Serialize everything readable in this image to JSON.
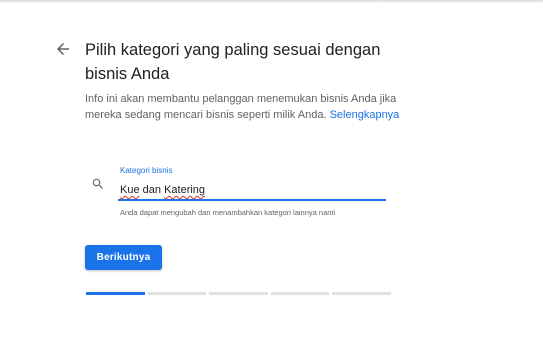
{
  "header": {
    "title": "Pilih kategori yang paling sesuai dengan bisnis Anda"
  },
  "description": {
    "text": "Info ini akan membantu pelanggan menemukan bisnis Anda jika mereka sedang mencari bisnis seperti milik Anda.",
    "link_label": "Selengkapnya"
  },
  "category_field": {
    "label": "Kategori bisnis",
    "value_word_1": "Kue",
    "value_word_2": "dan",
    "value_word_3": "Katering",
    "helper": "Anda dapat mengubah dan menambahkan kategori lainnya nanti"
  },
  "actions": {
    "next_label": "Berikutnya"
  },
  "progress": {
    "total_steps": 5,
    "current_step": 1
  },
  "colors": {
    "accent": "#1a73e8",
    "text_primary": "#202124",
    "text_secondary": "#5f6368",
    "track": "#e0e0e0"
  },
  "icons": {
    "back": "arrow-left-icon",
    "search": "search-icon"
  }
}
